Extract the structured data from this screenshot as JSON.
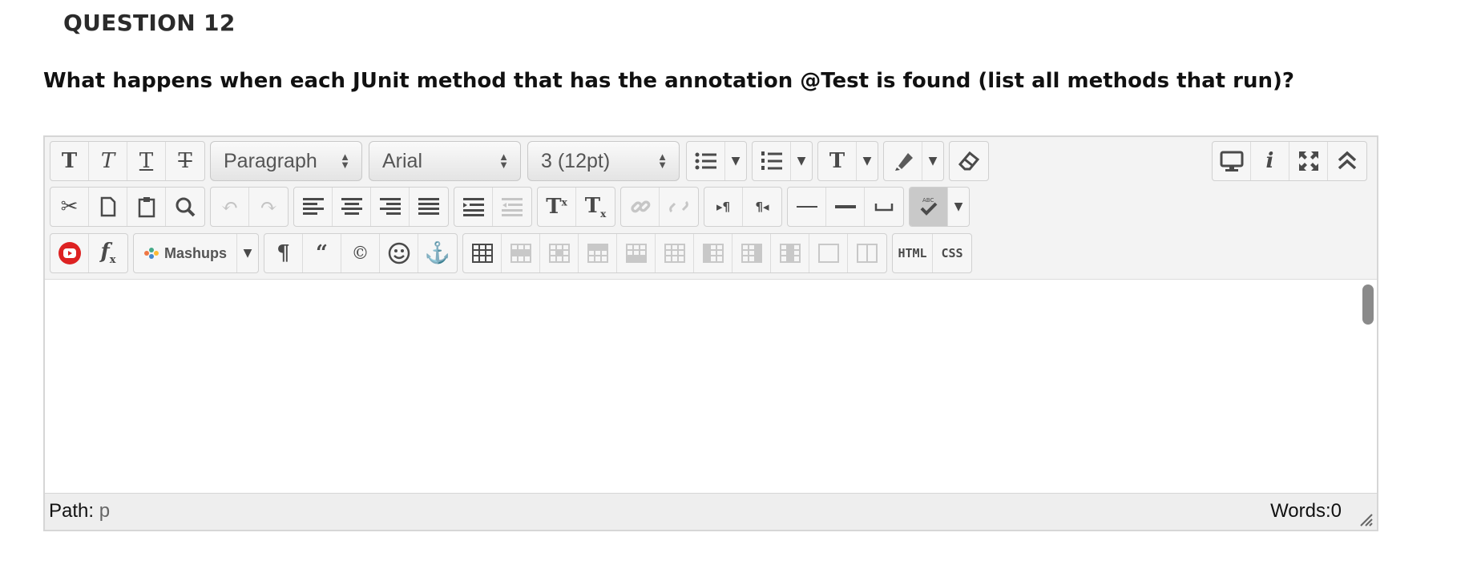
{
  "question": {
    "title": "QUESTION 12",
    "text": "What happens when each JUnit method that has the annotation @Test is found (list all methods that run)?"
  },
  "toolbar": {
    "format_select": "Paragraph",
    "font_select": "Arial",
    "size_select": "3 (12pt)",
    "mashups_label": "Mashups",
    "html_label": "HTML",
    "css_label": "CSS"
  },
  "editor": {
    "content": ""
  },
  "status": {
    "path_label": "Path:",
    "path_value": "p",
    "words": "Words:0"
  }
}
